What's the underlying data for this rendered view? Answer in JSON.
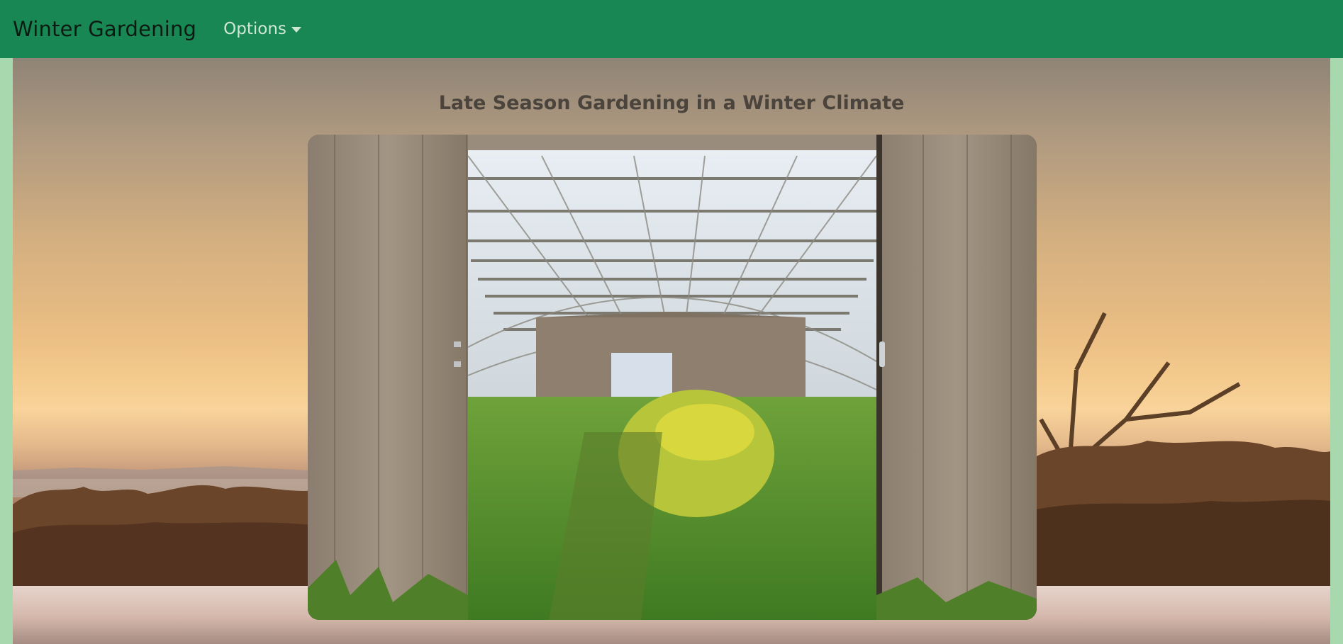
{
  "navbar": {
    "brand": "Winter Gardening",
    "options_label": "Options"
  },
  "main": {
    "title": "Late Season Gardening in a Winter Climate"
  },
  "colors": {
    "navbar": "#198754",
    "page_edge": "#a8d8ad",
    "title_text": "#4a443d"
  },
  "icons": {
    "dropdown_caret": "caret-down-icon"
  }
}
